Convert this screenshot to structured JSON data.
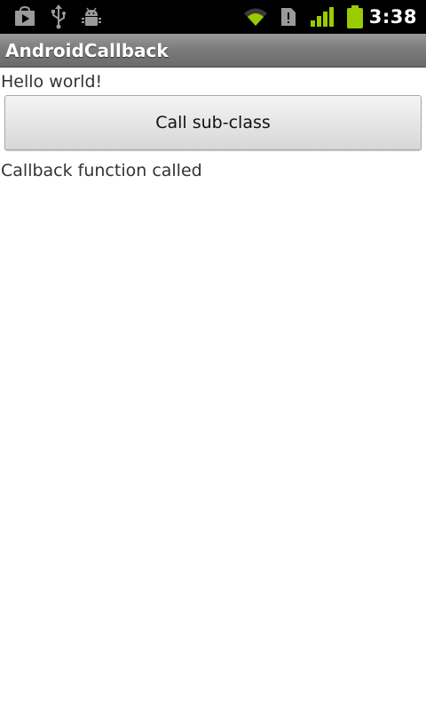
{
  "status_bar": {
    "time": "3:38",
    "icons_left": [
      "play-store-icon",
      "usb-icon",
      "android-debug-icon"
    ],
    "icons_right": [
      "wifi-icon",
      "sd-card-icon",
      "signal-icon",
      "battery-icon"
    ],
    "accent_color": "#99cc00"
  },
  "title_bar": {
    "title": "AndroidCallback"
  },
  "main": {
    "hello_text": "Hello world!",
    "button_label": "Call sub-class",
    "callback_text": "Callback function called"
  }
}
